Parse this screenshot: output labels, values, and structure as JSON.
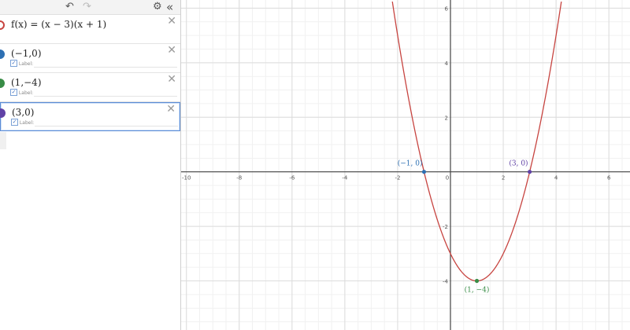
{
  "toolbar": {
    "undo_icon": "undo-icon",
    "redo_icon": "redo-icon",
    "settings_icon": "gear-icon",
    "collapse_icon": "double-chevron-left-icon"
  },
  "expressions": [
    {
      "text": "f(x) = (x − 3)(x + 1)",
      "color": "#c74440"
    },
    {
      "text": "(−1,0)",
      "color": "#2d70b3",
      "label_text": "Label:"
    },
    {
      "text": "(1,−4)",
      "color": "#388c46",
      "label_text": "Label:"
    },
    {
      "text": "(3,0)",
      "color": "#6042a6",
      "label_text": "Label:"
    }
  ],
  "graph": {
    "x_ticks": [
      "-10",
      "-8",
      "-6",
      "-4",
      "-2",
      "0",
      "2",
      "4",
      "6"
    ],
    "y_ticks": [
      "6",
      "4",
      "2",
      "-2",
      "-4"
    ],
    "x_range": [
      -10.2,
      6.8
    ],
    "y_range": [
      -5.8,
      6.3
    ],
    "curve_color": "#c74440",
    "points": [
      {
        "label": "(−1, 0)",
        "x": -1,
        "y": 0,
        "color": "#2d70b3",
        "label_pos": "above-left"
      },
      {
        "label": "(1, −4)",
        "x": 1,
        "y": -4,
        "color": "#388c46",
        "label_pos": "below"
      },
      {
        "label": "(3, 0)",
        "x": 3,
        "y": 0,
        "color": "#6042a6",
        "label_pos": "above-left"
      }
    ]
  }
}
